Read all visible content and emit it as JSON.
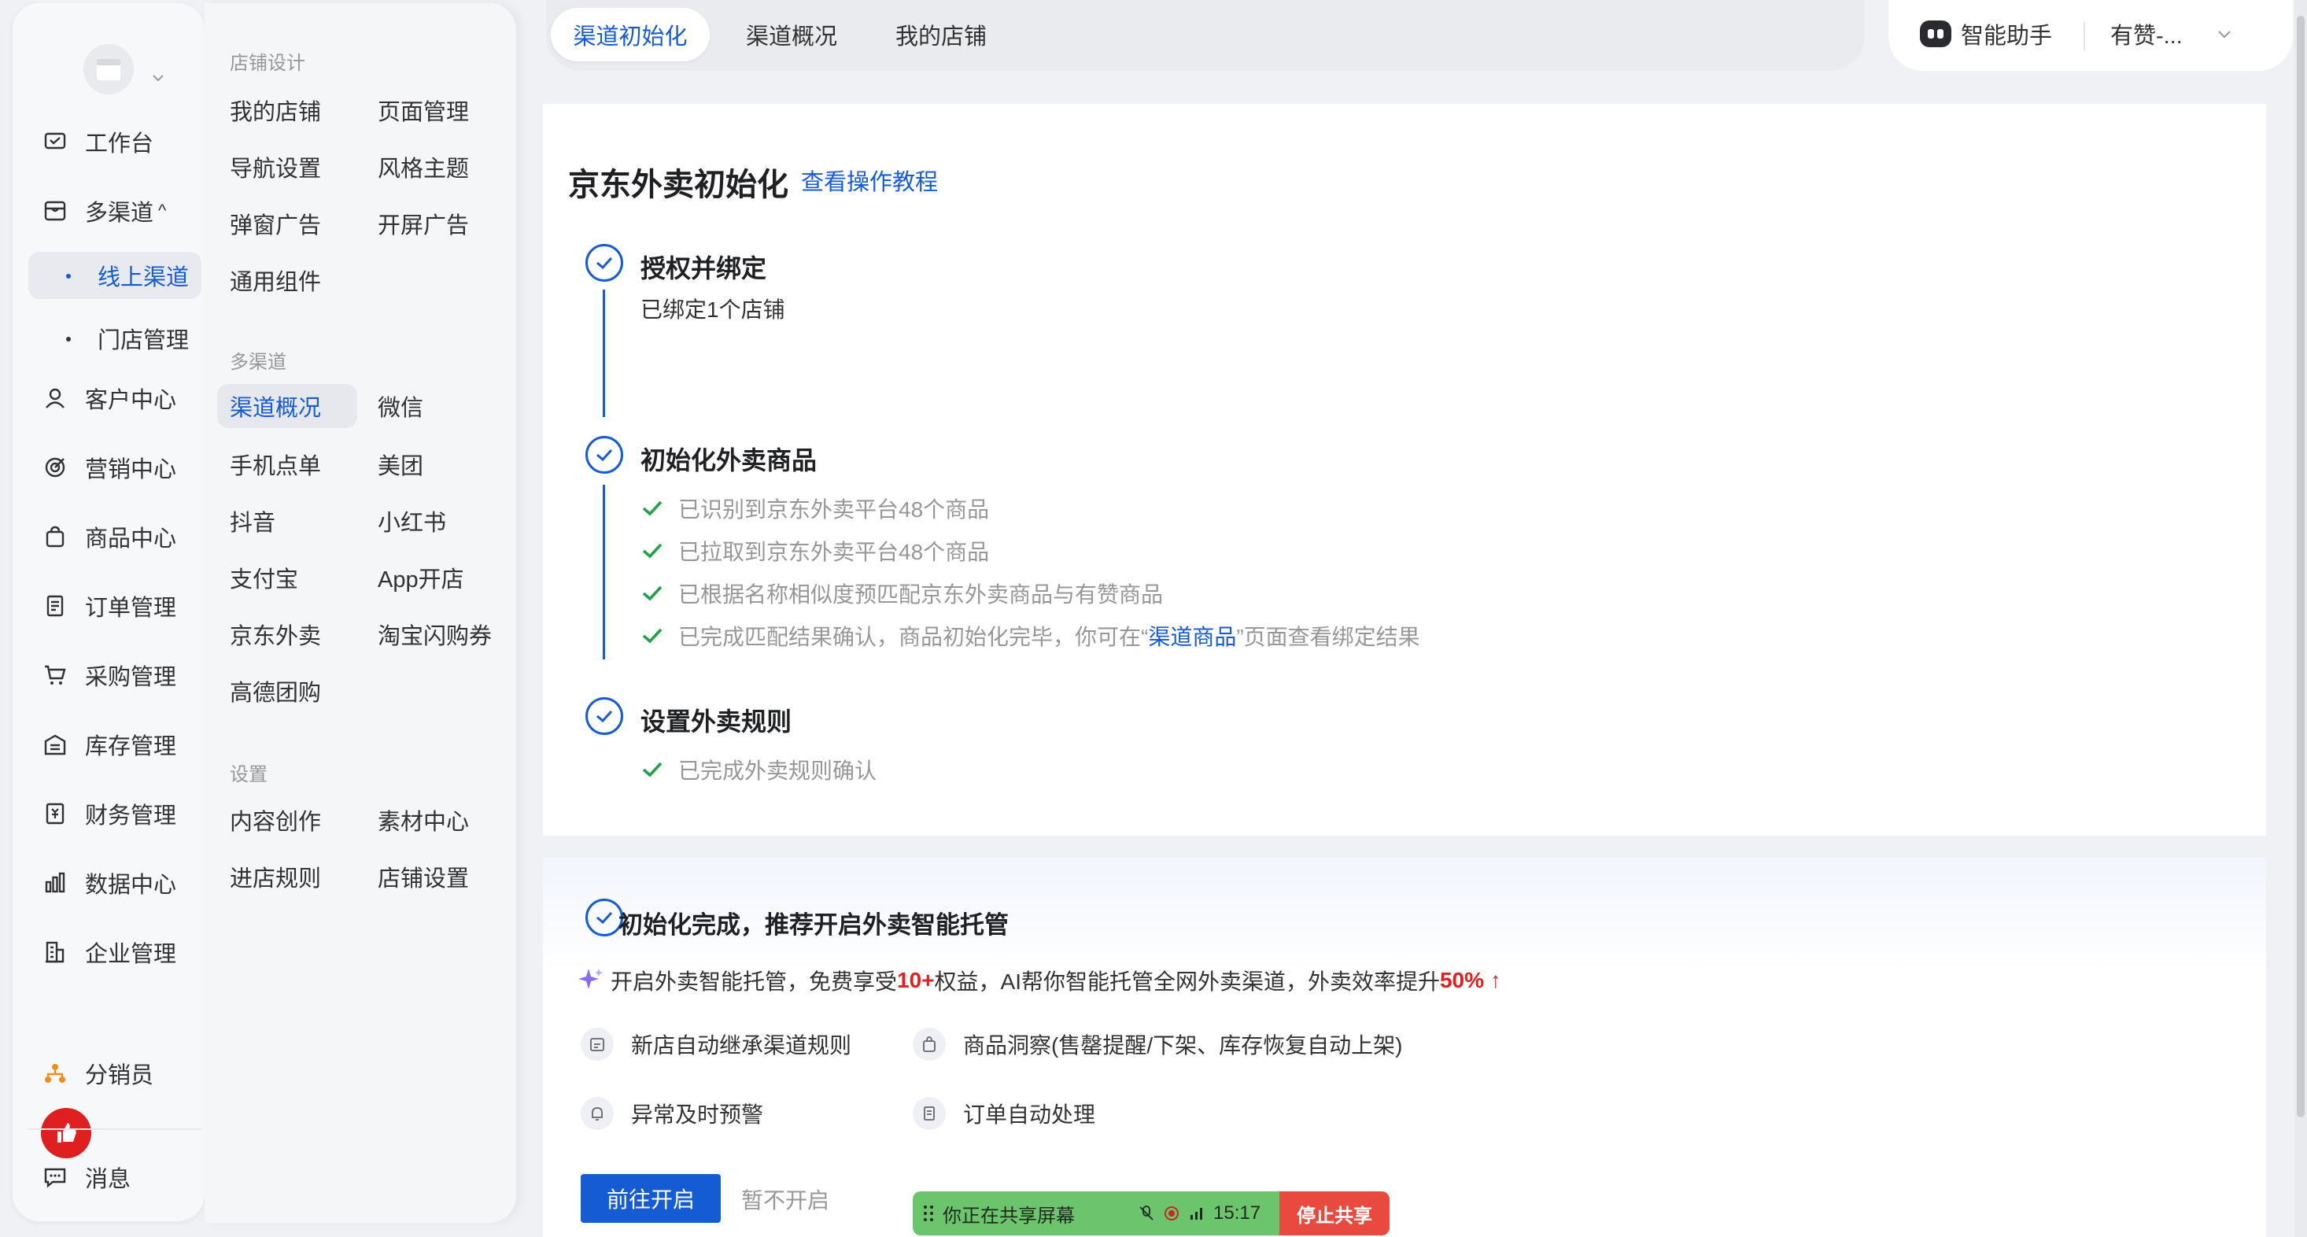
{
  "sidebar": {
    "items": [
      {
        "label": "工作台",
        "icon": "workbench-icon"
      },
      {
        "label": "多渠道",
        "icon": "multichannel-icon"
      },
      {
        "label": "线上渠道"
      },
      {
        "label": "门店管理"
      },
      {
        "label": "客户中心",
        "icon": "user-icon"
      },
      {
        "label": "营销中心",
        "icon": "target-icon"
      },
      {
        "label": "商品中心",
        "icon": "bag-icon"
      },
      {
        "label": "订单管理",
        "icon": "order-icon"
      },
      {
        "label": "采购管理",
        "icon": "cart-icon"
      },
      {
        "label": "库存管理",
        "icon": "warehouse-icon"
      },
      {
        "label": "财务管理",
        "icon": "finance-icon"
      },
      {
        "label": "数据中心",
        "icon": "chart-icon"
      },
      {
        "label": "企业管理",
        "icon": "building-icon"
      },
      {
        "label": "分销员",
        "icon": "distributor-icon"
      },
      {
        "label": "消息",
        "icon": "message-icon"
      }
    ],
    "expanded_caret": "^"
  },
  "submenu": {
    "groups": [
      {
        "title": "店铺设计",
        "links": [
          "我的店铺",
          "页面管理",
          "导航设置",
          "风格主题",
          "弹窗广告",
          "开屏广告",
          "通用组件"
        ]
      },
      {
        "title": "多渠道",
        "links": [
          "渠道概况",
          "微信",
          "手机点单",
          "美团",
          "抖音",
          "小红书",
          "支付宝",
          "App开店",
          "京东外卖",
          "淘宝闪购券",
          "高德团购"
        ]
      },
      {
        "title": "设置",
        "links": [
          "内容创作",
          "素材中心",
          "进店规则",
          "店铺设置"
        ]
      }
    ]
  },
  "tabs": [
    "渠道初始化",
    "渠道概况",
    "我的店铺"
  ],
  "topbar": {
    "assistant_label": "智能助手",
    "account_label": "有赞-..."
  },
  "main": {
    "title": "京东外卖初始化",
    "tutorial_link": "查看操作教程",
    "steps": [
      {
        "title": "授权并绑定",
        "desc": "已绑定1个店铺"
      },
      {
        "title": "初始化外卖商品",
        "checks": [
          "已识别到京东外卖平台48个商品",
          "已拉取到京东外卖平台48个商品",
          "已根据名称相似度预匹配京东外卖商品与有赞商品"
        ],
        "last_check": {
          "prefix": "已完成匹配结果确认，商品初始化完毕，你可在“",
          "link": "渠道商品",
          "suffix": "”页面查看绑定结果"
        }
      },
      {
        "title": "设置外卖规则",
        "checks": [
          "已完成外卖规则确认"
        ]
      }
    ]
  },
  "recommend": {
    "title": "初始化完成，推荐开启外卖智能托管",
    "promo_prefix": "开启外卖智能托管，免费享受",
    "promo_highlight1": "10+",
    "promo_mid": "权益，AI帮你智能托管全网外卖渠道，外卖效率提升",
    "promo_highlight2": "50% ↑",
    "features": [
      "新店自动继承渠道规则",
      "商品洞察(售罄提醒/下架、库存恢复自动上架)",
      "异常及时预警",
      "订单自动处理"
    ],
    "primary_button": "前往开启",
    "secondary_button": "暂不开启"
  },
  "share_bar": {
    "text": "你正在共享屏幕",
    "time": "15:17",
    "stop": "停止共享"
  },
  "colors": {
    "accent": "#155bd4",
    "check": "#24a148",
    "highlight": "#e02020"
  }
}
